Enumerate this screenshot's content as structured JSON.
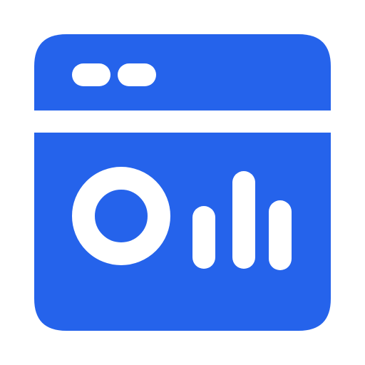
{
  "icon": {
    "name": "analytics-dashboard-window-icon",
    "colors": {
      "primary": "#2563EB",
      "secondary": "#FFFFFF",
      "background": "#FFFFFF"
    },
    "elements": {
      "window_dots": 2,
      "donut_chart": "ring",
      "bar_chart_bars": 3
    }
  }
}
